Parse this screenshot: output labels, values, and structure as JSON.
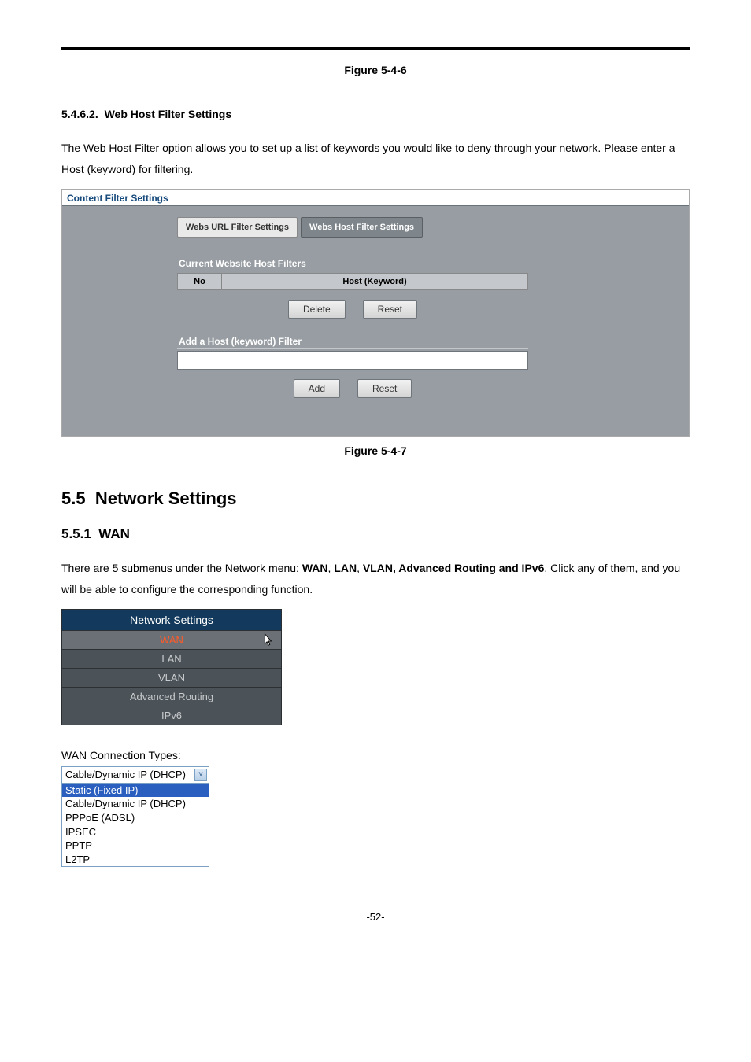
{
  "figure_top": "Figure 5-4-6",
  "section_5462": {
    "num": "5.4.6.2.",
    "title": "Web Host Filter Settings",
    "para": "The Web Host Filter option allows you to set up a list of keywords you would like to deny through your network. Please enter a Host (keyword) for filtering."
  },
  "panel": {
    "label": "Content Filter Settings",
    "tabs": [
      "Webs URL Filter Settings",
      "Webs Host Filter Settings"
    ],
    "active_tab": 1,
    "section1_title": "Current Website Host Filters",
    "table_headers": [
      "No",
      "Host (Keyword)"
    ],
    "btn_delete": "Delete",
    "btn_reset": "Reset",
    "section2_title": "Add a Host (keyword) Filter",
    "btn_add": "Add",
    "btn_reset2": "Reset"
  },
  "figure_mid": "Figure 5-4-7",
  "sec55": {
    "num": "5.5",
    "title": "Network Settings"
  },
  "sec551": {
    "num": "5.5.1",
    "title": "WAN",
    "para_pre": "There are 5 submenus under the Network menu: ",
    "bold_wan": "WAN",
    "bold_lan": "LAN",
    "bold_rest": "VLAN, Advanced Routing and IPv6",
    "para_post": ". Click any of them, and you will be able to configure the corresponding function."
  },
  "netmenu": {
    "header": "Network Settings",
    "items": [
      "WAN",
      "LAN",
      "VLAN",
      "Advanced Routing",
      "IPv6"
    ],
    "active": 0
  },
  "wan_conn_label": "WAN Connection Types:",
  "dropdown": {
    "selected": "Cable/Dynamic IP (DHCP)",
    "options": [
      "Static (Fixed IP)",
      "Cable/Dynamic IP (DHCP)",
      "PPPoE (ADSL)",
      "IPSEC",
      "PPTP",
      "L2TP"
    ],
    "highlighted": 0
  },
  "page_num": "-52-"
}
